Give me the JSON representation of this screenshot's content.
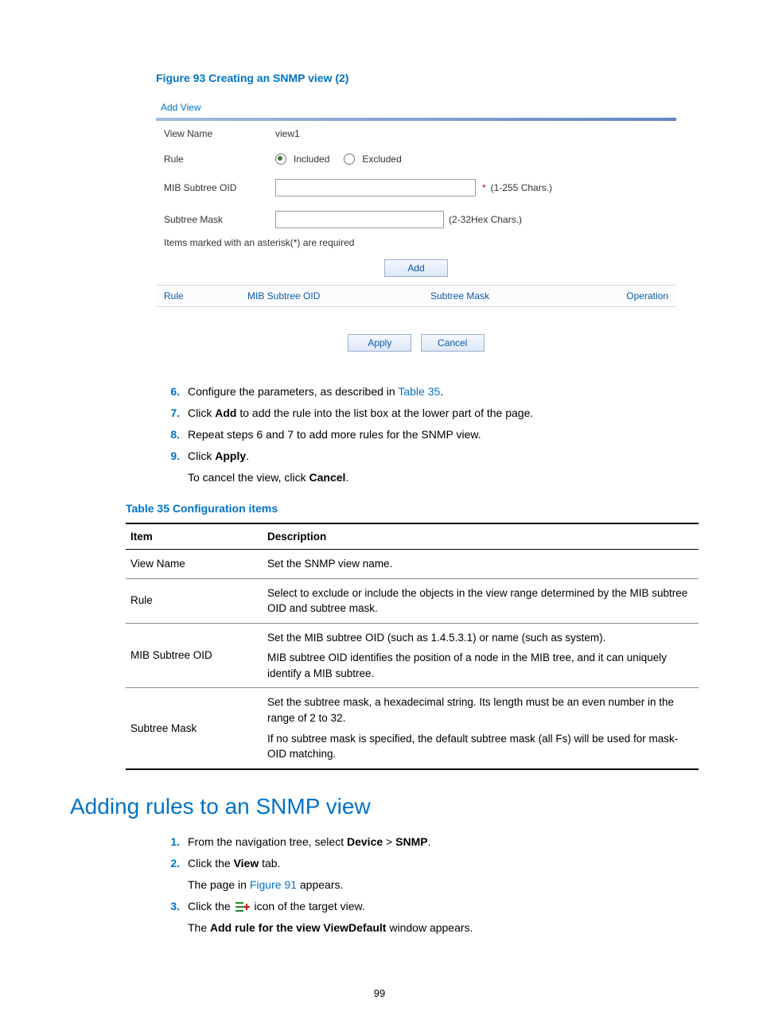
{
  "figure": {
    "caption": "Figure 93 Creating an SNMP view (2)"
  },
  "form": {
    "header": "Add View",
    "labels": {
      "view_name": "View Name",
      "rule": "Rule",
      "mib_oid": "MIB Subtree OID",
      "subtree_mask": "Subtree Mask"
    },
    "values": {
      "view_name": "view1",
      "rule_included": "Included",
      "rule_excluded": "Excluded",
      "mib_oid_hint": "(1-255 Chars.)",
      "mask_hint": "(2-32Hex Chars.)"
    },
    "note": "Items marked with an asterisk(*) are required",
    "buttons": {
      "add": "Add",
      "apply": "Apply",
      "cancel": "Cancel"
    },
    "columns": {
      "rule": "Rule",
      "oid": "MIB Subtree OID",
      "mask": "Subtree Mask",
      "op": "Operation"
    }
  },
  "steps": [
    {
      "num": "6.",
      "parts": [
        "Configure the parameters, as described in ",
        "Table 35",
        "."
      ]
    },
    {
      "num": "7.",
      "parts": [
        "Click ",
        "Add",
        " to add the rule into the list box at the lower part of the page."
      ]
    },
    {
      "num": "8.",
      "parts": [
        "Repeat steps 6 and 7 to add more rules for the SNMP view."
      ]
    },
    {
      "num": "9.",
      "parts": [
        "Click ",
        "Apply",
        "."
      ],
      "sub_parts": [
        "To cancel the view, click ",
        "Cancel",
        "."
      ]
    }
  ],
  "table": {
    "caption": "Table 35 Configuration items",
    "head": {
      "item": "Item",
      "desc": "Description"
    },
    "rows": [
      {
        "item": "View Name",
        "desc": [
          "Set the SNMP view name."
        ]
      },
      {
        "item": "Rule",
        "desc": [
          "Select to exclude or include the objects in the view range determined by the MIB subtree OID and subtree mask."
        ]
      },
      {
        "item": "MIB Subtree OID",
        "desc": [
          "Set the MIB subtree OID (such as 1.4.5.3.1) or name (such as system).",
          "MIB subtree OID identifies the position of a node in the MIB tree, and it can uniquely identify a MIB subtree."
        ]
      },
      {
        "item": "Subtree Mask",
        "desc": [
          "Set the subtree mask, a hexadecimal string. Its length must be an even number in the range of 2 to 32.",
          "If no subtree mask is specified, the default subtree mask (all Fs) will be used for mask-OID matching."
        ]
      }
    ]
  },
  "section2": {
    "title": "Adding rules to an SNMP view",
    "steps": [
      {
        "num": "1.",
        "parts": [
          "From the navigation tree, select ",
          "Device",
          " > ",
          "SNMP",
          "."
        ]
      },
      {
        "num": "2.",
        "parts": [
          "Click the ",
          "View",
          " tab."
        ],
        "sub_parts": [
          "The page in ",
          "Figure 91",
          " appears."
        ]
      },
      {
        "num": "3.",
        "parts": [
          "Click the ",
          "__ICON__",
          " icon of the target view."
        ],
        "sub_parts": [
          "The ",
          "Add rule for the view ViewDefault",
          " window appears."
        ]
      }
    ]
  },
  "page_number": "99"
}
